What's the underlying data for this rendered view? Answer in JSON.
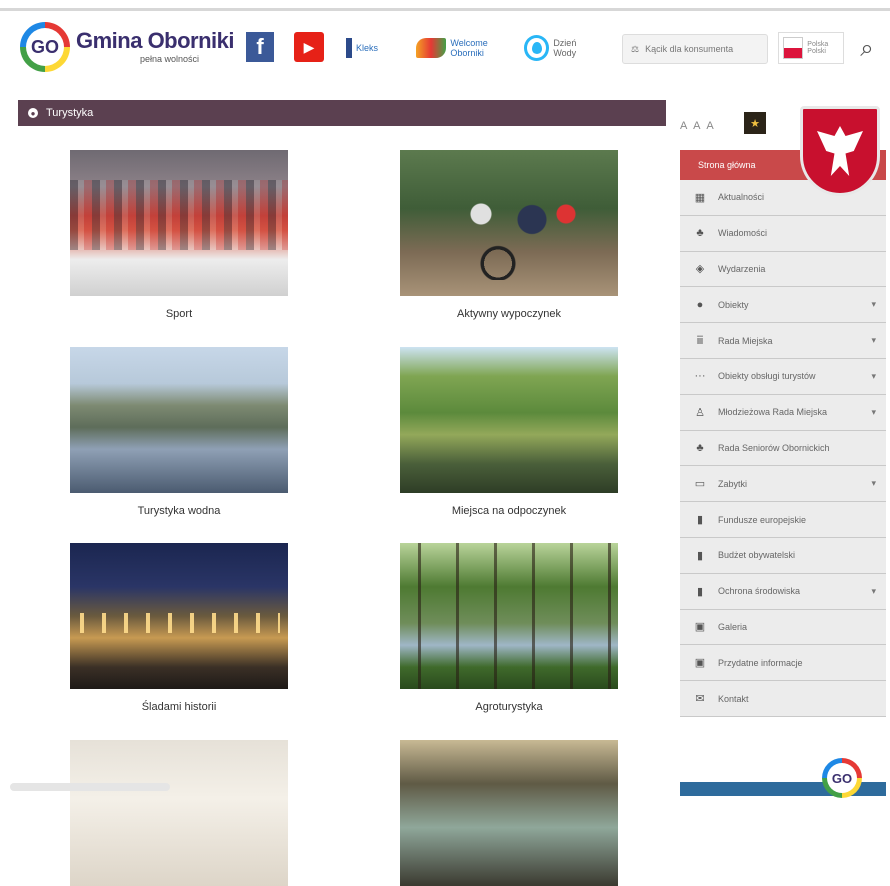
{
  "header": {
    "logo_badge": "GO",
    "logo_text": "Gmina Oborniki",
    "logo_sub": "pełna wolności",
    "links": [
      {
        "icon": "facebook-icon",
        "label": "f"
      },
      {
        "icon": "youtube-icon",
        "label": "▶"
      },
      {
        "icon": "kleks-icon",
        "label": "Kleks"
      },
      {
        "icon": "welcome-icon",
        "label": "Welcome Oborniki"
      },
      {
        "icon": "water-drop-icon",
        "label": "Dzień Wody"
      }
    ],
    "portal_button": "Kącik dla konsumenta",
    "flag_label": "Polska Polski",
    "search_label": "⌕"
  },
  "section": {
    "title": "Turystyka"
  },
  "tiles": [
    {
      "caption": "Sport"
    },
    {
      "caption": "Aktywny wypoczynek"
    },
    {
      "caption": "Turystyka wodna"
    },
    {
      "caption": "Miejsca na odpoczynek"
    },
    {
      "caption": "Śladami historii"
    },
    {
      "caption": "Agroturystyka"
    },
    {
      "caption": ""
    },
    {
      "caption": ""
    }
  ],
  "sidebar": {
    "font_sizes": "A A A",
    "contrast_label": "★",
    "menu_head": "Strona główna",
    "items": [
      {
        "label": "Aktualności",
        "icon": "calendar-icon",
        "glyph": "▦",
        "chevron": ""
      },
      {
        "label": "Wiadomości",
        "icon": "people-icon",
        "glyph": "♣",
        "chevron": ""
      },
      {
        "label": "Wydarzenia",
        "icon": "ticket-icon",
        "glyph": "◈",
        "chevron": ""
      },
      {
        "label": "Obiekty",
        "icon": "globe-icon",
        "glyph": "●",
        "chevron": "▾"
      },
      {
        "label": "Rada Miejska",
        "icon": "council-icon",
        "glyph": "ⅲ",
        "chevron": "▾"
      },
      {
        "label": "Obiekty obsługi turystów",
        "icon": "info-icon",
        "glyph": "···",
        "chevron": "▾"
      },
      {
        "label": "Młodzieżowa Rada Miejska",
        "icon": "person-icon",
        "glyph": "♙",
        "chevron": "▾"
      },
      {
        "label": "Rada Seniorów Obornickich",
        "icon": "group-icon",
        "glyph": "♣",
        "chevron": ""
      },
      {
        "label": "Zabytki",
        "icon": "car-icon",
        "glyph": "▭",
        "chevron": "▾"
      },
      {
        "label": "Fundusze europejskie",
        "icon": "document-icon",
        "glyph": "▮",
        "chevron": ""
      },
      {
        "label": "Budżet obywatelski",
        "icon": "document-icon",
        "glyph": "▮",
        "chevron": ""
      },
      {
        "label": "Ochrona środowiska",
        "icon": "document-icon",
        "glyph": "▮",
        "chevron": "▾"
      },
      {
        "label": "Galeria",
        "icon": "gallery-icon",
        "glyph": "▣",
        "chevron": ""
      },
      {
        "label": "Przydatne informacje",
        "icon": "gallery-icon",
        "glyph": "▣",
        "chevron": ""
      },
      {
        "label": "Kontakt",
        "icon": "contact-icon",
        "glyph": "✉",
        "chevron": ""
      }
    ]
  },
  "promo_badge": "GO",
  "colors": {
    "section_bar": "#5b4050",
    "menu_head": "#c9494a",
    "brand": "#3a2f6e"
  }
}
